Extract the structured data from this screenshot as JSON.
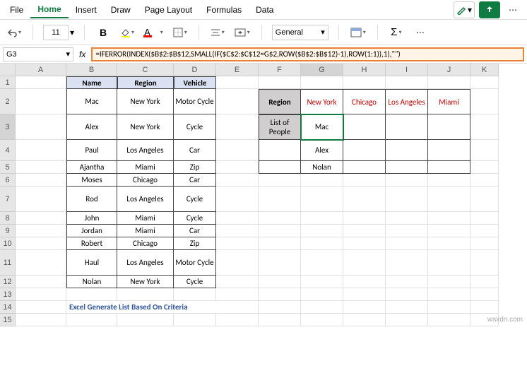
{
  "menu": {
    "items": [
      "File",
      "Home",
      "Insert",
      "Draw",
      "Page Layout",
      "Formulas",
      "Data"
    ],
    "active": "Home"
  },
  "toolbar": {
    "font_size": "11",
    "number_format": "General"
  },
  "formula_bar": {
    "cell_ref": "G3",
    "formula": "=IFERROR(INDEX($B$2:$B$12,SMALL(IF($C$2:$C$12=G$2,ROW($B$2:$B$12)-1),ROW(1:1)),1),\"\")"
  },
  "colwidths": {
    "A": 72,
    "B": 72,
    "C": 80,
    "D": 60,
    "E": 60,
    "F": 60,
    "G": 60,
    "H": 60,
    "I": 60,
    "J": 60,
    "K": 40
  },
  "rowheights": {
    "1": 18,
    "2": 36,
    "3": 36,
    "4": 30,
    "5": 18,
    "6": 18,
    "7": 36,
    "8": 18,
    "9": 18,
    "10": 18,
    "11": 36,
    "12": 18,
    "13": 18,
    "14": 18,
    "15": 18
  },
  "columns": [
    "A",
    "B",
    "C",
    "D",
    "E",
    "F",
    "G",
    "H",
    "I",
    "J",
    "K"
  ],
  "rows": [
    1,
    2,
    3,
    4,
    5,
    6,
    7,
    8,
    9,
    10,
    11,
    12,
    13,
    14,
    15
  ],
  "table1": {
    "headers": [
      "Name",
      "Region",
      "Vehicle"
    ],
    "data": [
      [
        "Mac",
        "New York",
        "Motor Cycle"
      ],
      [
        "Alex",
        "New York",
        "Cycle"
      ],
      [
        "Paul",
        "Los Angeles",
        "Car"
      ],
      [
        "Ajantha",
        "Miami",
        "Zip"
      ],
      [
        "Moses",
        "Chicago",
        "Car"
      ],
      [
        "Rod",
        "Los Angeles",
        "Cycle"
      ],
      [
        "John",
        "Miami",
        "Cycle"
      ],
      [
        "Jordan",
        "Miami",
        "Car"
      ],
      [
        "Robert",
        "Chicago",
        "Zip"
      ],
      [
        "Haul",
        "Los Angeles",
        "Motor Cycle"
      ],
      [
        "Nolan",
        "New York",
        "Cycle"
      ]
    ]
  },
  "table2": {
    "row_header1": "Region",
    "row_header2": "List of People",
    "regions": [
      "New York",
      "Chicago",
      "Los Angeles",
      "Miami"
    ],
    "people": [
      [
        "Mac",
        "",
        "",
        ""
      ],
      [
        "Alex",
        "",
        "",
        ""
      ],
      [
        "Nolan",
        "",
        "",
        ""
      ]
    ]
  },
  "title_text": "Excel Generate List Based On Criteria",
  "watermark": "wsxdn.com",
  "selected_cell": "G3"
}
